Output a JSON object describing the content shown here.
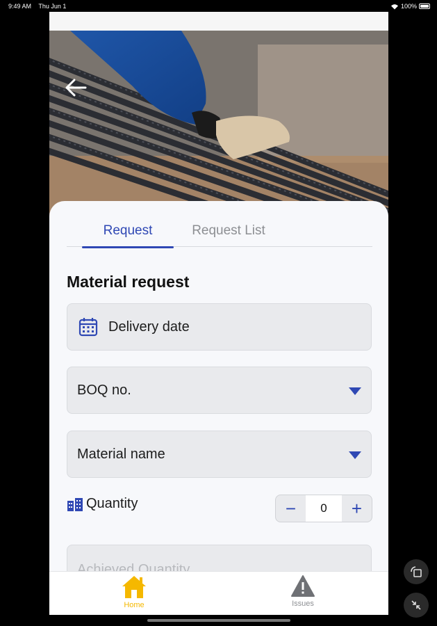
{
  "status_bar": {
    "time": "9:49 AM",
    "date": "Thu Jun 1",
    "battery": "100%"
  },
  "hero": {
    "back_icon": "arrow-left-icon",
    "image": "steel-rebar-photo"
  },
  "tabs": [
    {
      "label": "Request",
      "active": true
    },
    {
      "label": "Request List",
      "active": false
    }
  ],
  "form": {
    "title": "Material request",
    "delivery_date": {
      "label": "Delivery date",
      "icon": "calendar-icon"
    },
    "boq": {
      "label": "BOQ no.",
      "icon": "caret-down-icon"
    },
    "material": {
      "label": "Material name",
      "icon": "caret-down-icon"
    },
    "quantity": {
      "label": "Quantity",
      "icon": "buildings-icon",
      "value": "0",
      "minus": "−",
      "plus": "+"
    },
    "achieved_quantity": {
      "placeholder": "Achieved Quantity"
    }
  },
  "bottom_nav": [
    {
      "label": "Home",
      "icon": "home-icon",
      "active": true
    },
    {
      "label": "Issues",
      "icon": "warning-icon",
      "active": false
    }
  ],
  "colors": {
    "accent": "#2f48b4",
    "home_active": "#f5b800",
    "background": "#f7f8fb"
  }
}
